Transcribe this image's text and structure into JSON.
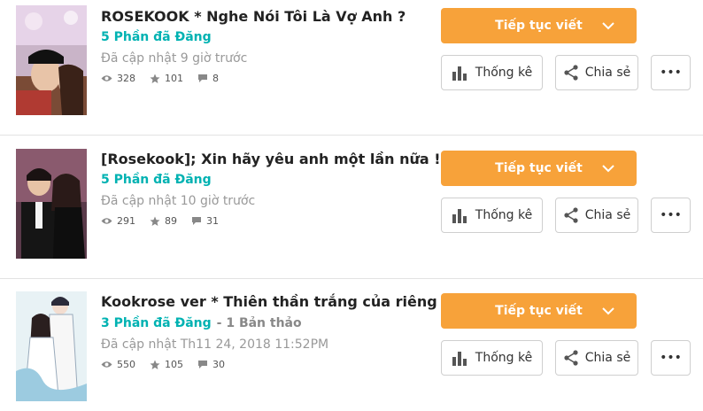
{
  "stories": [
    {
      "title": "ROSEKOOK * Nghe Nói Tôi Là Vợ Anh ?",
      "parts": "5 Phần đã Đăng",
      "drafts": "",
      "updated": "Đã cập nhật 9 giờ trước",
      "views": "328",
      "votes": "101",
      "comments": "8"
    },
    {
      "title": "[Rosekook]; Xin hãy yêu anh một lần nữa !",
      "parts": "5 Phần đã Đăng",
      "drafts": "",
      "updated": "Đã cập nhật 10 giờ trước",
      "views": "291",
      "votes": "89",
      "comments": "31"
    },
    {
      "title": "Kookrose ver * Thiên thần trắng của riêng anh !",
      "parts": "3 Phần đã Đăng",
      "drafts": "- 1 Bản thảo",
      "updated": "Đã cập nhật Th11 24, 2018 11:52PM",
      "views": "550",
      "votes": "105",
      "comments": "30"
    }
  ],
  "buttons": {
    "continue_label": "Tiếp tục viết",
    "stats_label": "Thống kê",
    "share_label": "Chia sẻ",
    "more_label": "•••"
  },
  "icons": {
    "views": "eye-icon",
    "votes": "star-icon",
    "comments": "comment-icon",
    "stats": "bar-chart-icon",
    "share": "share-icon",
    "dropdown": "chevron-down-icon"
  },
  "colors": {
    "accent": "#f7a23a",
    "parts": "#00b2b2",
    "muted": "#999999"
  }
}
